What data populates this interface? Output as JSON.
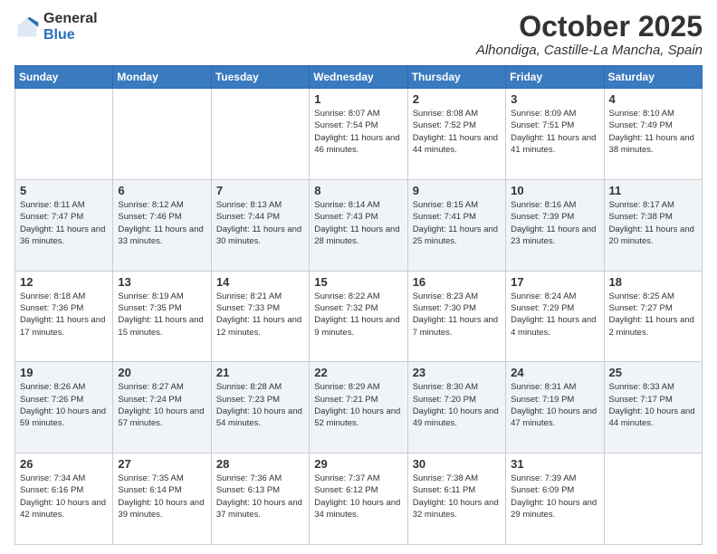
{
  "logo": {
    "general": "General",
    "blue": "Blue"
  },
  "title": "October 2025",
  "location": "Alhondiga, Castille-La Mancha, Spain",
  "days_of_week": [
    "Sunday",
    "Monday",
    "Tuesday",
    "Wednesday",
    "Thursday",
    "Friday",
    "Saturday"
  ],
  "weeks": [
    [
      {
        "day": "",
        "sunrise": "",
        "sunset": "",
        "daylight": ""
      },
      {
        "day": "",
        "sunrise": "",
        "sunset": "",
        "daylight": ""
      },
      {
        "day": "",
        "sunrise": "",
        "sunset": "",
        "daylight": ""
      },
      {
        "day": "1",
        "sunrise": "Sunrise: 8:07 AM",
        "sunset": "Sunset: 7:54 PM",
        "daylight": "Daylight: 11 hours and 46 minutes."
      },
      {
        "day": "2",
        "sunrise": "Sunrise: 8:08 AM",
        "sunset": "Sunset: 7:52 PM",
        "daylight": "Daylight: 11 hours and 44 minutes."
      },
      {
        "day": "3",
        "sunrise": "Sunrise: 8:09 AM",
        "sunset": "Sunset: 7:51 PM",
        "daylight": "Daylight: 11 hours and 41 minutes."
      },
      {
        "day": "4",
        "sunrise": "Sunrise: 8:10 AM",
        "sunset": "Sunset: 7:49 PM",
        "daylight": "Daylight: 11 hours and 38 minutes."
      }
    ],
    [
      {
        "day": "5",
        "sunrise": "Sunrise: 8:11 AM",
        "sunset": "Sunset: 7:47 PM",
        "daylight": "Daylight: 11 hours and 36 minutes."
      },
      {
        "day": "6",
        "sunrise": "Sunrise: 8:12 AM",
        "sunset": "Sunset: 7:46 PM",
        "daylight": "Daylight: 11 hours and 33 minutes."
      },
      {
        "day": "7",
        "sunrise": "Sunrise: 8:13 AM",
        "sunset": "Sunset: 7:44 PM",
        "daylight": "Daylight: 11 hours and 30 minutes."
      },
      {
        "day": "8",
        "sunrise": "Sunrise: 8:14 AM",
        "sunset": "Sunset: 7:43 PM",
        "daylight": "Daylight: 11 hours and 28 minutes."
      },
      {
        "day": "9",
        "sunrise": "Sunrise: 8:15 AM",
        "sunset": "Sunset: 7:41 PM",
        "daylight": "Daylight: 11 hours and 25 minutes."
      },
      {
        "day": "10",
        "sunrise": "Sunrise: 8:16 AM",
        "sunset": "Sunset: 7:39 PM",
        "daylight": "Daylight: 11 hours and 23 minutes."
      },
      {
        "day": "11",
        "sunrise": "Sunrise: 8:17 AM",
        "sunset": "Sunset: 7:38 PM",
        "daylight": "Daylight: 11 hours and 20 minutes."
      }
    ],
    [
      {
        "day": "12",
        "sunrise": "Sunrise: 8:18 AM",
        "sunset": "Sunset: 7:36 PM",
        "daylight": "Daylight: 11 hours and 17 minutes."
      },
      {
        "day": "13",
        "sunrise": "Sunrise: 8:19 AM",
        "sunset": "Sunset: 7:35 PM",
        "daylight": "Daylight: 11 hours and 15 minutes."
      },
      {
        "day": "14",
        "sunrise": "Sunrise: 8:21 AM",
        "sunset": "Sunset: 7:33 PM",
        "daylight": "Daylight: 11 hours and 12 minutes."
      },
      {
        "day": "15",
        "sunrise": "Sunrise: 8:22 AM",
        "sunset": "Sunset: 7:32 PM",
        "daylight": "Daylight: 11 hours and 9 minutes."
      },
      {
        "day": "16",
        "sunrise": "Sunrise: 8:23 AM",
        "sunset": "Sunset: 7:30 PM",
        "daylight": "Daylight: 11 hours and 7 minutes."
      },
      {
        "day": "17",
        "sunrise": "Sunrise: 8:24 AM",
        "sunset": "Sunset: 7:29 PM",
        "daylight": "Daylight: 11 hours and 4 minutes."
      },
      {
        "day": "18",
        "sunrise": "Sunrise: 8:25 AM",
        "sunset": "Sunset: 7:27 PM",
        "daylight": "Daylight: 11 hours and 2 minutes."
      }
    ],
    [
      {
        "day": "19",
        "sunrise": "Sunrise: 8:26 AM",
        "sunset": "Sunset: 7:26 PM",
        "daylight": "Daylight: 10 hours and 59 minutes."
      },
      {
        "day": "20",
        "sunrise": "Sunrise: 8:27 AM",
        "sunset": "Sunset: 7:24 PM",
        "daylight": "Daylight: 10 hours and 57 minutes."
      },
      {
        "day": "21",
        "sunrise": "Sunrise: 8:28 AM",
        "sunset": "Sunset: 7:23 PM",
        "daylight": "Daylight: 10 hours and 54 minutes."
      },
      {
        "day": "22",
        "sunrise": "Sunrise: 8:29 AM",
        "sunset": "Sunset: 7:21 PM",
        "daylight": "Daylight: 10 hours and 52 minutes."
      },
      {
        "day": "23",
        "sunrise": "Sunrise: 8:30 AM",
        "sunset": "Sunset: 7:20 PM",
        "daylight": "Daylight: 10 hours and 49 minutes."
      },
      {
        "day": "24",
        "sunrise": "Sunrise: 8:31 AM",
        "sunset": "Sunset: 7:19 PM",
        "daylight": "Daylight: 10 hours and 47 minutes."
      },
      {
        "day": "25",
        "sunrise": "Sunrise: 8:33 AM",
        "sunset": "Sunset: 7:17 PM",
        "daylight": "Daylight: 10 hours and 44 minutes."
      }
    ],
    [
      {
        "day": "26",
        "sunrise": "Sunrise: 7:34 AM",
        "sunset": "Sunset: 6:16 PM",
        "daylight": "Daylight: 10 hours and 42 minutes."
      },
      {
        "day": "27",
        "sunrise": "Sunrise: 7:35 AM",
        "sunset": "Sunset: 6:14 PM",
        "daylight": "Daylight: 10 hours and 39 minutes."
      },
      {
        "day": "28",
        "sunrise": "Sunrise: 7:36 AM",
        "sunset": "Sunset: 6:13 PM",
        "daylight": "Daylight: 10 hours and 37 minutes."
      },
      {
        "day": "29",
        "sunrise": "Sunrise: 7:37 AM",
        "sunset": "Sunset: 6:12 PM",
        "daylight": "Daylight: 10 hours and 34 minutes."
      },
      {
        "day": "30",
        "sunrise": "Sunrise: 7:38 AM",
        "sunset": "Sunset: 6:11 PM",
        "daylight": "Daylight: 10 hours and 32 minutes."
      },
      {
        "day": "31",
        "sunrise": "Sunrise: 7:39 AM",
        "sunset": "Sunset: 6:09 PM",
        "daylight": "Daylight: 10 hours and 29 minutes."
      },
      {
        "day": "",
        "sunrise": "",
        "sunset": "",
        "daylight": ""
      }
    ]
  ]
}
